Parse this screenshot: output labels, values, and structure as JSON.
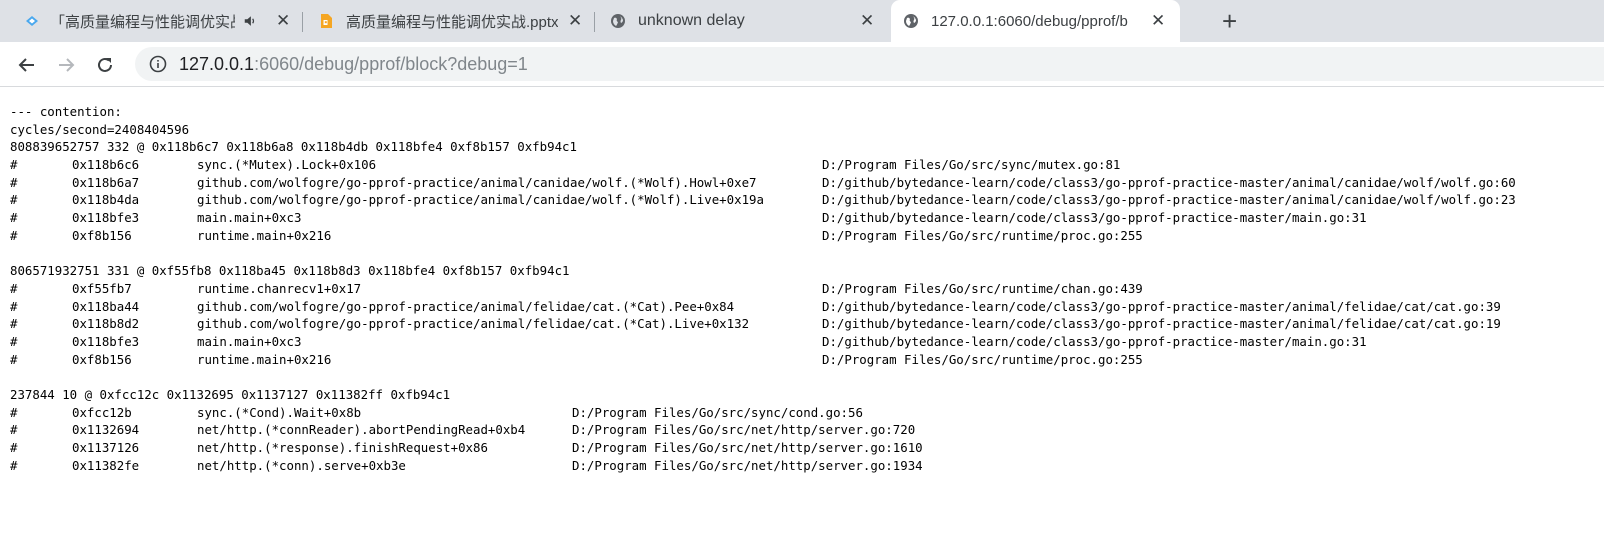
{
  "tabs": [
    {
      "title": "「高质量编程与性能调优实战",
      "favicon": "video-tab-icon",
      "audio": true
    },
    {
      "title": "高质量编程与性能调优实战.pptx",
      "favicon": "slides-icon"
    },
    {
      "title": "unknown delay",
      "favicon": "globe-icon"
    },
    {
      "title": "127.0.0.1:6060/debug/pprof/b",
      "favicon": "globe-icon",
      "active": true
    }
  ],
  "address": {
    "host": "127.0.0.1",
    "rest": ":6060/debug/pprof/block?debug=1"
  },
  "header": [
    "--- contention:",
    "cycles/second=2408404596"
  ],
  "blocks": [
    {
      "head": "808839652757 332 @ 0x118b6c7 0x118b6a8 0x118b4db 0x118bfe4 0xf8b157 0xfb94c1",
      "frames": [
        {
          "addr": "0x118b6c6",
          "fn": "sync.(*Mutex).Lock+0x106",
          "file": "D:/Program Files/Go/src/sync/mutex.go:81"
        },
        {
          "addr": "0x118b6a7",
          "fn": "github.com/wolfogre/go-pprof-practice/animal/canidae/wolf.(*Wolf).Howl+0xe7",
          "file": "D:/github/bytedance-learn/code/class3/go-pprof-practice-master/animal/canidae/wolf/wolf.go:60"
        },
        {
          "addr": "0x118b4da",
          "fn": "github.com/wolfogre/go-pprof-practice/animal/canidae/wolf.(*Wolf).Live+0x19a",
          "file": "D:/github/bytedance-learn/code/class3/go-pprof-practice-master/animal/canidae/wolf/wolf.go:23"
        },
        {
          "addr": "0x118bfe3",
          "fn": "main.main+0xc3",
          "file": "D:/github/bytedance-learn/code/class3/go-pprof-practice-master/main.go:31"
        },
        {
          "addr": "0xf8b156",
          "fn": "runtime.main+0x216",
          "file": "D:/Program Files/Go/src/runtime/proc.go:255"
        }
      ]
    },
    {
      "head": "806571932751 331 @ 0xf55fb8 0x118ba45 0x118b8d3 0x118bfe4 0xf8b157 0xfb94c1",
      "frames": [
        {
          "addr": "0xf55fb7",
          "fn": "runtime.chanrecv1+0x17",
          "file": "D:/Program Files/Go/src/runtime/chan.go:439"
        },
        {
          "addr": "0x118ba44",
          "fn": "github.com/wolfogre/go-pprof-practice/animal/felidae/cat.(*Cat).Pee+0x84",
          "file": "D:/github/bytedance-learn/code/class3/go-pprof-practice-master/animal/felidae/cat/cat.go:39"
        },
        {
          "addr": "0x118b8d2",
          "fn": "github.com/wolfogre/go-pprof-practice/animal/felidae/cat.(*Cat).Live+0x132",
          "file": "D:/github/bytedance-learn/code/class3/go-pprof-practice-master/animal/felidae/cat/cat.go:19"
        },
        {
          "addr": "0x118bfe3",
          "fn": "main.main+0xc3",
          "file": "D:/github/bytedance-learn/code/class3/go-pprof-practice-master/main.go:31"
        },
        {
          "addr": "0xf8b156",
          "fn": "runtime.main+0x216",
          "file": "D:/Program Files/Go/src/runtime/proc.go:255"
        }
      ]
    },
    {
      "head": "237844 10 @ 0xfcc12c 0x1132695 0x1137127 0x11382ff 0xfb94c1",
      "narrow": true,
      "frames": [
        {
          "addr": "0xfcc12b",
          "fn": "sync.(*Cond).Wait+0x8b",
          "file": "D:/Program Files/Go/src/sync/cond.go:56"
        },
        {
          "addr": "0x1132694",
          "fn": "net/http.(*connReader).abortPendingRead+0xb4",
          "file": "D:/Program Files/Go/src/net/http/server.go:720"
        },
        {
          "addr": "0x1137126",
          "fn": "net/http.(*response).finishRequest+0x86",
          "file": "D:/Program Files/Go/src/net/http/server.go:1610"
        },
        {
          "addr": "0x11382fe",
          "fn": "net/http.(*conn).serve+0xb3e",
          "file": "D:/Program Files/Go/src/net/http/server.go:1934"
        }
      ]
    }
  ]
}
